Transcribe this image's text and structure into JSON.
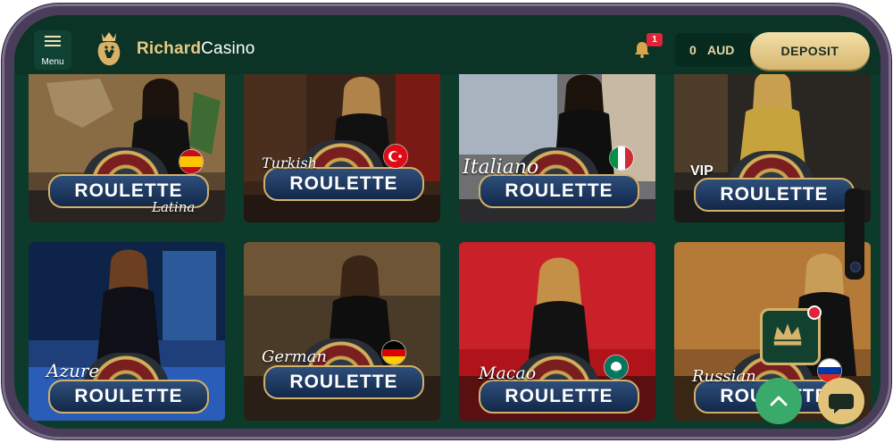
{
  "header": {
    "menu_label": "Menu",
    "brand_part1": "Richard",
    "brand_part2": "Casino",
    "notification_count": "1",
    "balance_amount": "0",
    "balance_currency": "AUD",
    "deposit_label": "DEPOSIT"
  },
  "games": [
    {
      "pill": "ROULETTE",
      "script": "Latina",
      "flag": "spain-flag"
    },
    {
      "pill": "ROULETTE",
      "script": "Turkish",
      "flag": "turkey-flag"
    },
    {
      "pill": "ROULETTE",
      "script": "Italiano",
      "flag": "italy-flag"
    },
    {
      "pill": "ROULETTE",
      "script": "VIP",
      "flag": ""
    },
    {
      "pill": "ROULETTE",
      "script": "Azure",
      "flag": ""
    },
    {
      "pill": "ROULETTE",
      "script": "German",
      "flag": "germany-flag"
    },
    {
      "pill": "ROULETTE",
      "script": "Macao",
      "flag": "macao-flag"
    },
    {
      "pill": "ROULETTE",
      "script": "Russian",
      "flag": "russia-flag"
    }
  ],
  "colors": {
    "background": "#0c3a2b",
    "accent_gold": "#d3b26c",
    "badge_red": "#e0243a"
  }
}
